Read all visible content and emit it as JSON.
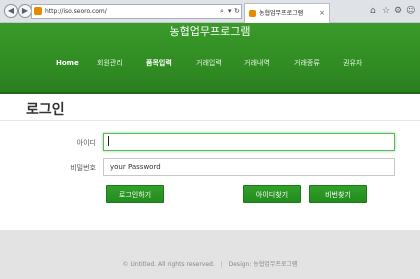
{
  "browser": {
    "url": "http://iso.seoro.com/",
    "tab_title": "농협업무프로그램",
    "back_glyph": "◀",
    "forward_glyph": "▶",
    "search_glyph": "⌕",
    "refresh_glyph": "↻",
    "dropdown_glyph": "▾",
    "close_glyph": "×",
    "home_glyph": "⌂",
    "star_glyph": "☆",
    "gear_glyph": "⚙",
    "smiley_glyph": "☺"
  },
  "header": {
    "title": "농협업무프로그램",
    "menu": [
      "Home",
      "회원관리",
      "품목입력",
      "거래입력",
      "거래내역",
      "거래종류",
      "권유자"
    ],
    "active_index": 2
  },
  "login": {
    "title": "로그인",
    "id_label": "아이디",
    "id_value": "",
    "password_label": "비밀번호",
    "password_value": "your Password",
    "login_button": "로그인하기",
    "find_id_button": "아이디찾기",
    "find_password_button": "비번찾기"
  },
  "footer": {
    "copyright": "© Untitled. All rights reserved.",
    "design": "Design: 농협업무프로그램"
  },
  "colors": {
    "header_green": "#2f8a22",
    "button_green": "#27921f",
    "footer_gray": "#e3e3e3"
  }
}
